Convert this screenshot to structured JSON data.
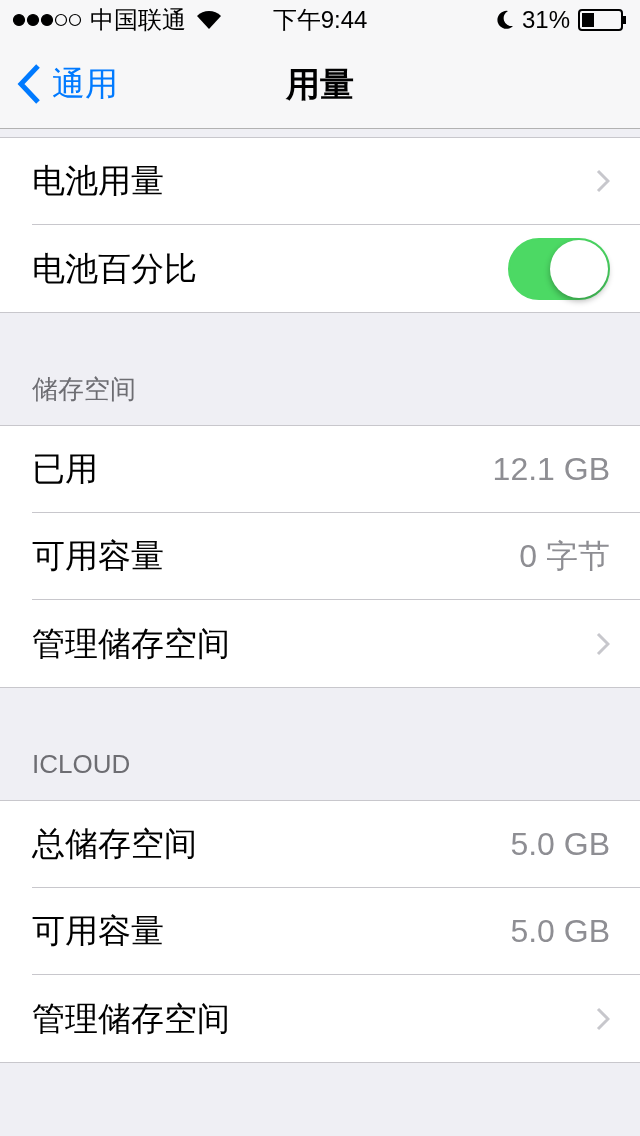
{
  "status_bar": {
    "carrier": "中国联通",
    "time": "下午9:44",
    "battery": "31%"
  },
  "nav": {
    "back": "通用",
    "title": "用量"
  },
  "sections": [
    {
      "rows": [
        {
          "kind": "disclosure",
          "label": "电池用量"
        },
        {
          "kind": "toggle",
          "label": "电池百分比",
          "on": true
        }
      ]
    },
    {
      "header": "储存空间",
      "rows": [
        {
          "kind": "value",
          "label": "已用",
          "value": "12.1 GB"
        },
        {
          "kind": "value",
          "label": "可用容量",
          "value": "0 字节"
        },
        {
          "kind": "disclosure",
          "label": "管理储存空间"
        }
      ]
    },
    {
      "header": "ICLOUD",
      "rows": [
        {
          "kind": "value",
          "label": "总储存空间",
          "value": "5.0 GB"
        },
        {
          "kind": "value",
          "label": "可用容量",
          "value": "5.0 GB"
        },
        {
          "kind": "disclosure",
          "label": "管理储存空间"
        }
      ]
    }
  ]
}
